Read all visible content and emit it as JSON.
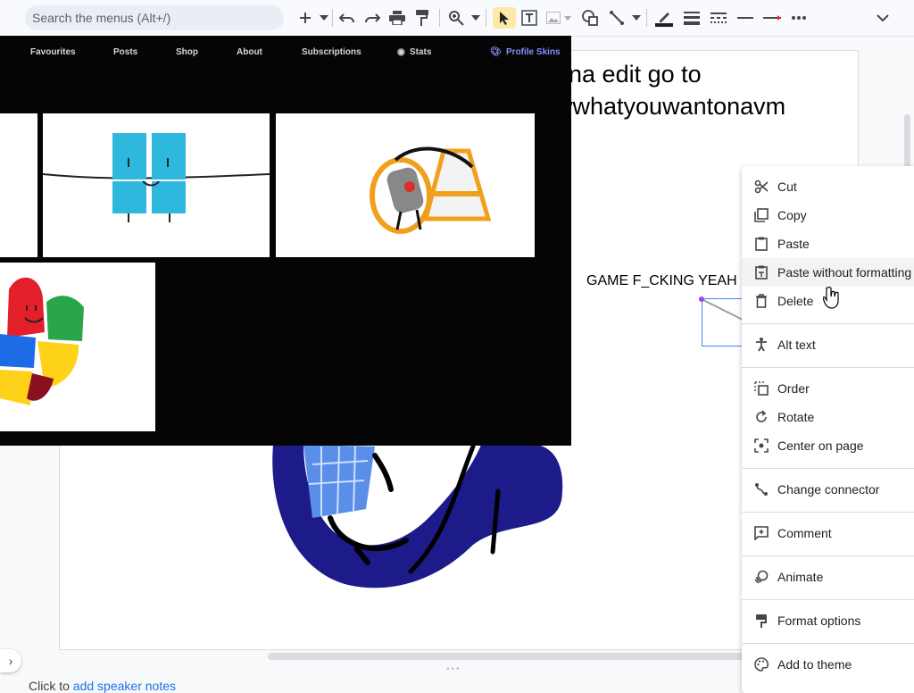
{
  "toolbar": {
    "search_placeholder": "Search the menus (Alt+/)"
  },
  "slide": {
    "text_line1": "nna edit go to",
    "text_line2": "wwhatyouwantonavm",
    "caption": "GAME F_CKING YEAH"
  },
  "pasted_site": {
    "nav": [
      "Favourites",
      "Posts",
      "Shop",
      "About",
      "Subscriptions",
      "Stats",
      "Profile Skins"
    ]
  },
  "notes": {
    "prefix": "Click to ",
    "link": "add speaker notes"
  },
  "context_menu": {
    "items": [
      {
        "label": "Cut",
        "icon": "scissors-icon"
      },
      {
        "label": "Copy",
        "icon": "copy-icon"
      },
      {
        "label": "Paste",
        "icon": "clipboard-icon"
      },
      {
        "label": "Paste without formatting",
        "icon": "clipboard-plain-icon"
      },
      {
        "label": "Delete",
        "icon": "trash-icon"
      },
      {
        "label": "Alt text",
        "icon": "accessibility-icon"
      },
      {
        "label": "Order",
        "icon": "order-icon"
      },
      {
        "label": "Rotate",
        "icon": "rotate-icon"
      },
      {
        "label": "Center on page",
        "icon": "center-icon"
      },
      {
        "label": "Change connector",
        "icon": "connector-icon"
      },
      {
        "label": "Comment",
        "icon": "comment-icon"
      },
      {
        "label": "Animate",
        "icon": "animate-icon"
      },
      {
        "label": "Format options",
        "icon": "format-icon"
      },
      {
        "label": "Add to theme",
        "icon": "palette-icon"
      }
    ]
  }
}
